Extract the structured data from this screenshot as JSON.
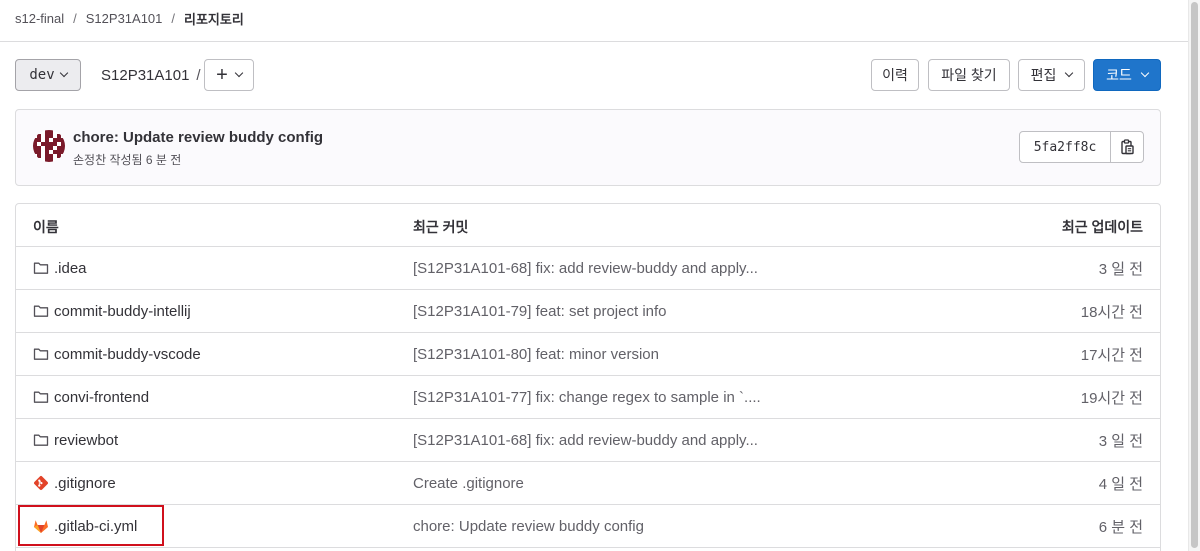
{
  "breadcrumb": {
    "items": [
      "s12-final",
      "S12P31A101"
    ],
    "current": "리포지토리",
    "separator": "/"
  },
  "toolbar": {
    "branch": "dev",
    "path": "S12P31A101",
    "path_separator": "/",
    "add_label": "+",
    "history_label": "이력",
    "find_file_label": "파일 찾기",
    "edit_label": "편집",
    "code_label": "코드"
  },
  "commit": {
    "title": "chore: Update review buddy config",
    "meta": "손정찬 작성됨 6 분 전",
    "sha": "5fa2ff8c"
  },
  "table": {
    "headers": {
      "name": "이름",
      "last_commit": "최근 커밋",
      "last_update": "최근 업데이트"
    },
    "rows": [
      {
        "icon": "folder-icon",
        "name": ".idea",
        "commit": "[S12P31A101-68] fix: add review-buddy and apply...",
        "updated": "3 일 전"
      },
      {
        "icon": "folder-icon",
        "name": "commit-buddy-intellij",
        "commit": "[S12P31A101-79] feat: set project info",
        "updated": "18시간 전"
      },
      {
        "icon": "folder-icon",
        "name": "commit-buddy-vscode",
        "commit": "[S12P31A101-80] feat: minor version",
        "updated": "17시간 전"
      },
      {
        "icon": "folder-icon",
        "name": "convi-frontend",
        "commit": "[S12P31A101-77] fix: change regex to sample in `....",
        "updated": "19시간 전"
      },
      {
        "icon": "folder-icon",
        "name": "reviewbot",
        "commit": "[S12P31A101-68] fix: add review-buddy and apply...",
        "updated": "3 일 전"
      },
      {
        "icon": "git-icon",
        "name": ".gitignore",
        "commit": "Create .gitignore",
        "updated": "4 일 전"
      },
      {
        "icon": "gitlab-icon",
        "name": ".gitlab-ci.yml",
        "commit": "chore: Update review buddy config",
        "updated": "6 분 전"
      }
    ]
  },
  "colors": {
    "primary": "#1f75cb",
    "highlight": "#d0101c",
    "border": "#dcdcde"
  }
}
